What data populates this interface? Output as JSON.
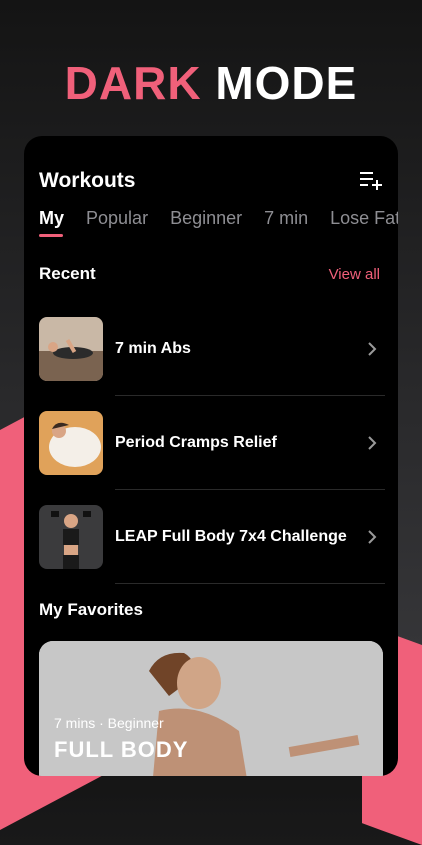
{
  "headline": {
    "part1": "DARK",
    "part2": "MODE"
  },
  "header": {
    "title": "Workouts"
  },
  "tabs": [
    {
      "label": "My"
    },
    {
      "label": "Popular"
    },
    {
      "label": "Beginner"
    },
    {
      "label": "7 min"
    },
    {
      "label": "Lose Fat"
    }
  ],
  "recent": {
    "title": "Recent",
    "view_all": "View all",
    "items": [
      {
        "label": "7 min Abs"
      },
      {
        "label": "Period Cramps Relief"
      },
      {
        "label": "LEAP Full Body 7x4 Challenge"
      }
    ]
  },
  "favorites": {
    "title": "My Favorites",
    "meta": "7 mins · Beginner",
    "card_title": "FULL BODY"
  },
  "colors": {
    "accent": "#f0607a",
    "card_bg": "#000000",
    "muted": "#8e8e93"
  }
}
